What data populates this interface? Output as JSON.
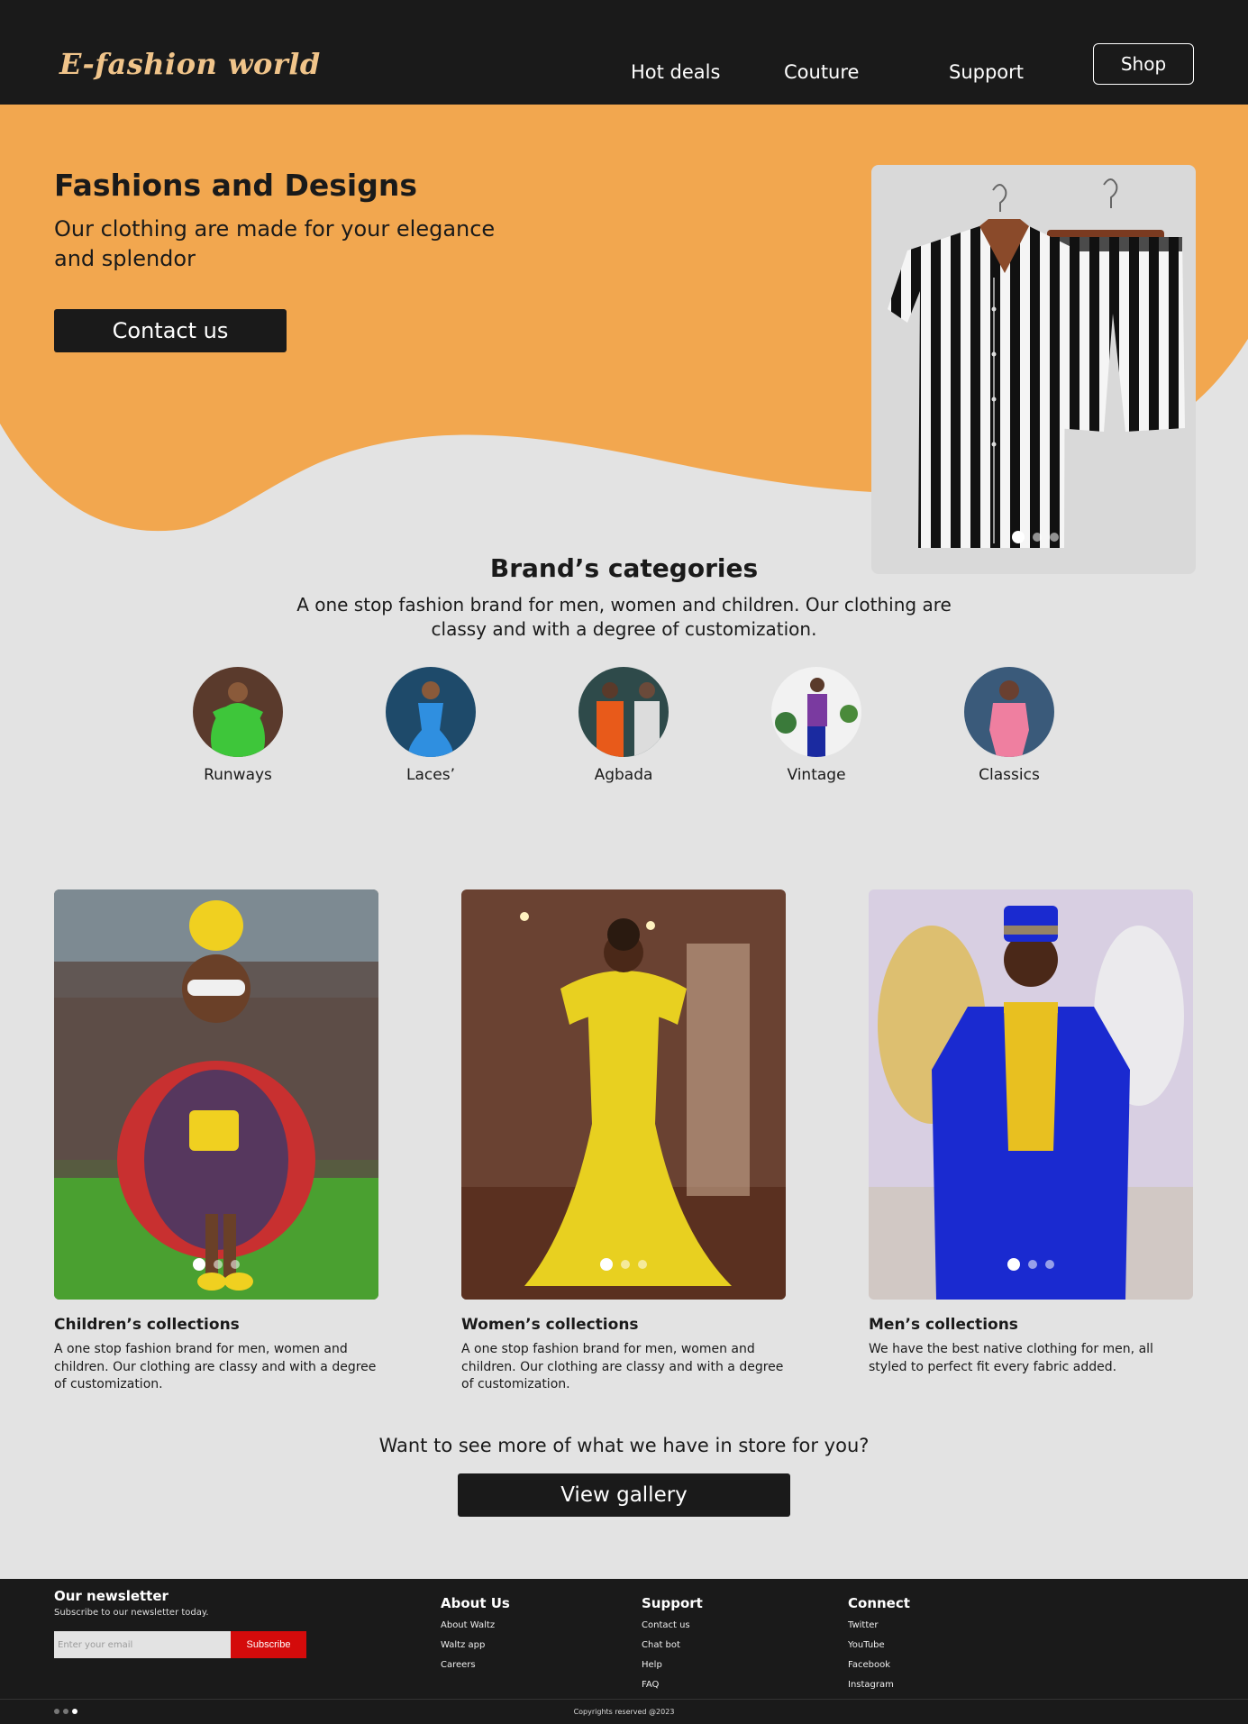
{
  "header": {
    "logo": "E-fashion world",
    "nav": [
      "Hot deals",
      "Couture",
      "Support"
    ],
    "shop_label": "Shop"
  },
  "hero": {
    "title": "Fashions and Designs",
    "subtitle": "Our clothing are made for your elegance and splendor",
    "contact_label": "Contact us",
    "carousel": {
      "slides": 3,
      "active": 1
    }
  },
  "categories": {
    "title": "Brand’s categories",
    "description": "A one stop fashion brand for men, women and children. Our clothing are classy and with a degree of customization.",
    "items": [
      {
        "label": "Runways"
      },
      {
        "label": "Laces’"
      },
      {
        "label": "Agbada"
      },
      {
        "label": "Vintage"
      },
      {
        "label": "Classics"
      }
    ]
  },
  "collections": [
    {
      "title": "Children’s collections",
      "description": "A one stop fashion brand for men, women and children. Our clothing are classy and with a degree of customization.",
      "carousel": {
        "slides": 3,
        "active": 1
      }
    },
    {
      "title": "Women’s collections",
      "description": "A one stop fashion brand for men, women and children. Our clothing are classy and with a degree of customization.",
      "carousel": {
        "slides": 3,
        "active": 1
      }
    },
    {
      "title": "Men’s collections",
      "description": "We have the best native clothing for men, all styled to perfect fit every fabric added.",
      "carousel": {
        "slides": 3,
        "active": 1
      }
    }
  ],
  "gallery": {
    "prompt": "Want to see more of what we have in store for you?",
    "button_label": "View gallery"
  },
  "footer": {
    "newsletter_title": "Our newsletter",
    "newsletter_sub": "Subscribe to our newsletter today.",
    "email_placeholder": "Enter your email",
    "subscribe_label": "Subscribe",
    "about": {
      "title": "About Us",
      "links": [
        "About  Waltz",
        "Waltz app",
        "Careers"
      ]
    },
    "support": {
      "title": "Support",
      "links": [
        "Contact us",
        "Chat bot",
        "Help",
        "FAQ"
      ]
    },
    "connect": {
      "title": "Connect",
      "links": [
        "Twitter",
        "YouTube",
        "Facebook",
        "Instagram"
      ]
    },
    "copyright": "Copyrights reserved @2023"
  },
  "colors": {
    "accent": "#f2a74f",
    "dark": "#1a1a1a",
    "background": "#e3e3e3",
    "logo": "#f0c48a",
    "subscribe": "#d40b0b"
  }
}
